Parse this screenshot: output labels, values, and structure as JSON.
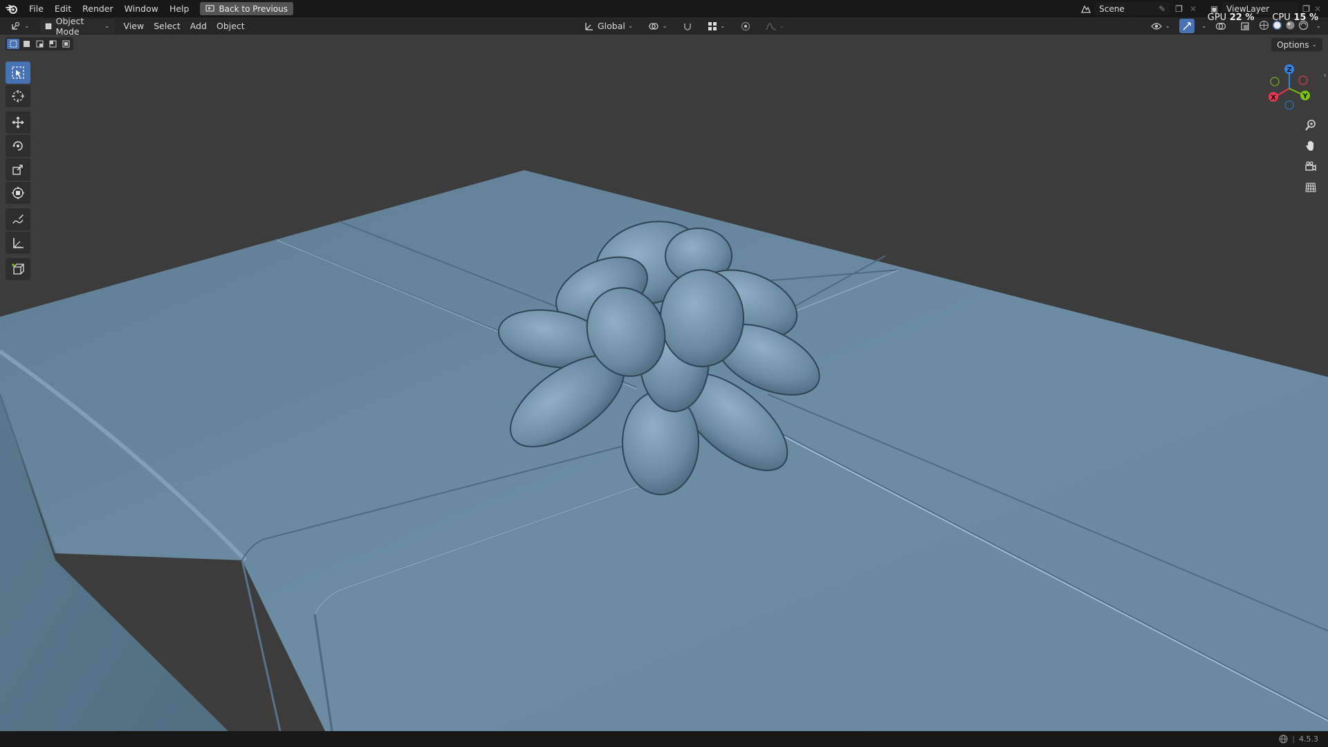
{
  "menubar": {
    "items": [
      "File",
      "Edit",
      "Render",
      "Window",
      "Help"
    ],
    "back_button": "Back to Previous",
    "scene": "Scene",
    "view_layer": "ViewLayer"
  },
  "performance": {
    "gpu_label": "GPU",
    "gpu_value": "22 %",
    "cpu_label": "CPU",
    "cpu_value": "15 %"
  },
  "header": {
    "mode": "Object Mode",
    "menus": [
      "View",
      "Select",
      "Add",
      "Object"
    ],
    "transform_orientation": "Global"
  },
  "viewport": {
    "options_label": "Options",
    "gizmo_axes": {
      "x": "X",
      "y": "Y",
      "z": "Z"
    }
  },
  "toolbar": {
    "tools": [
      "select-box-icon",
      "cursor-icon",
      "move-icon",
      "rotate-icon",
      "scale-icon",
      "transform-icon",
      "annotate-icon",
      "measure-icon",
      "add-cube-icon"
    ]
  },
  "statusbar": {
    "version": "4.5.3"
  },
  "colors": {
    "accent": "#4772b3",
    "model": "#6b8ca3",
    "background": "#3c3c3c",
    "axis_x": "#e8384f",
    "axis_y": "#7ac30e",
    "axis_z": "#2f83e8"
  }
}
